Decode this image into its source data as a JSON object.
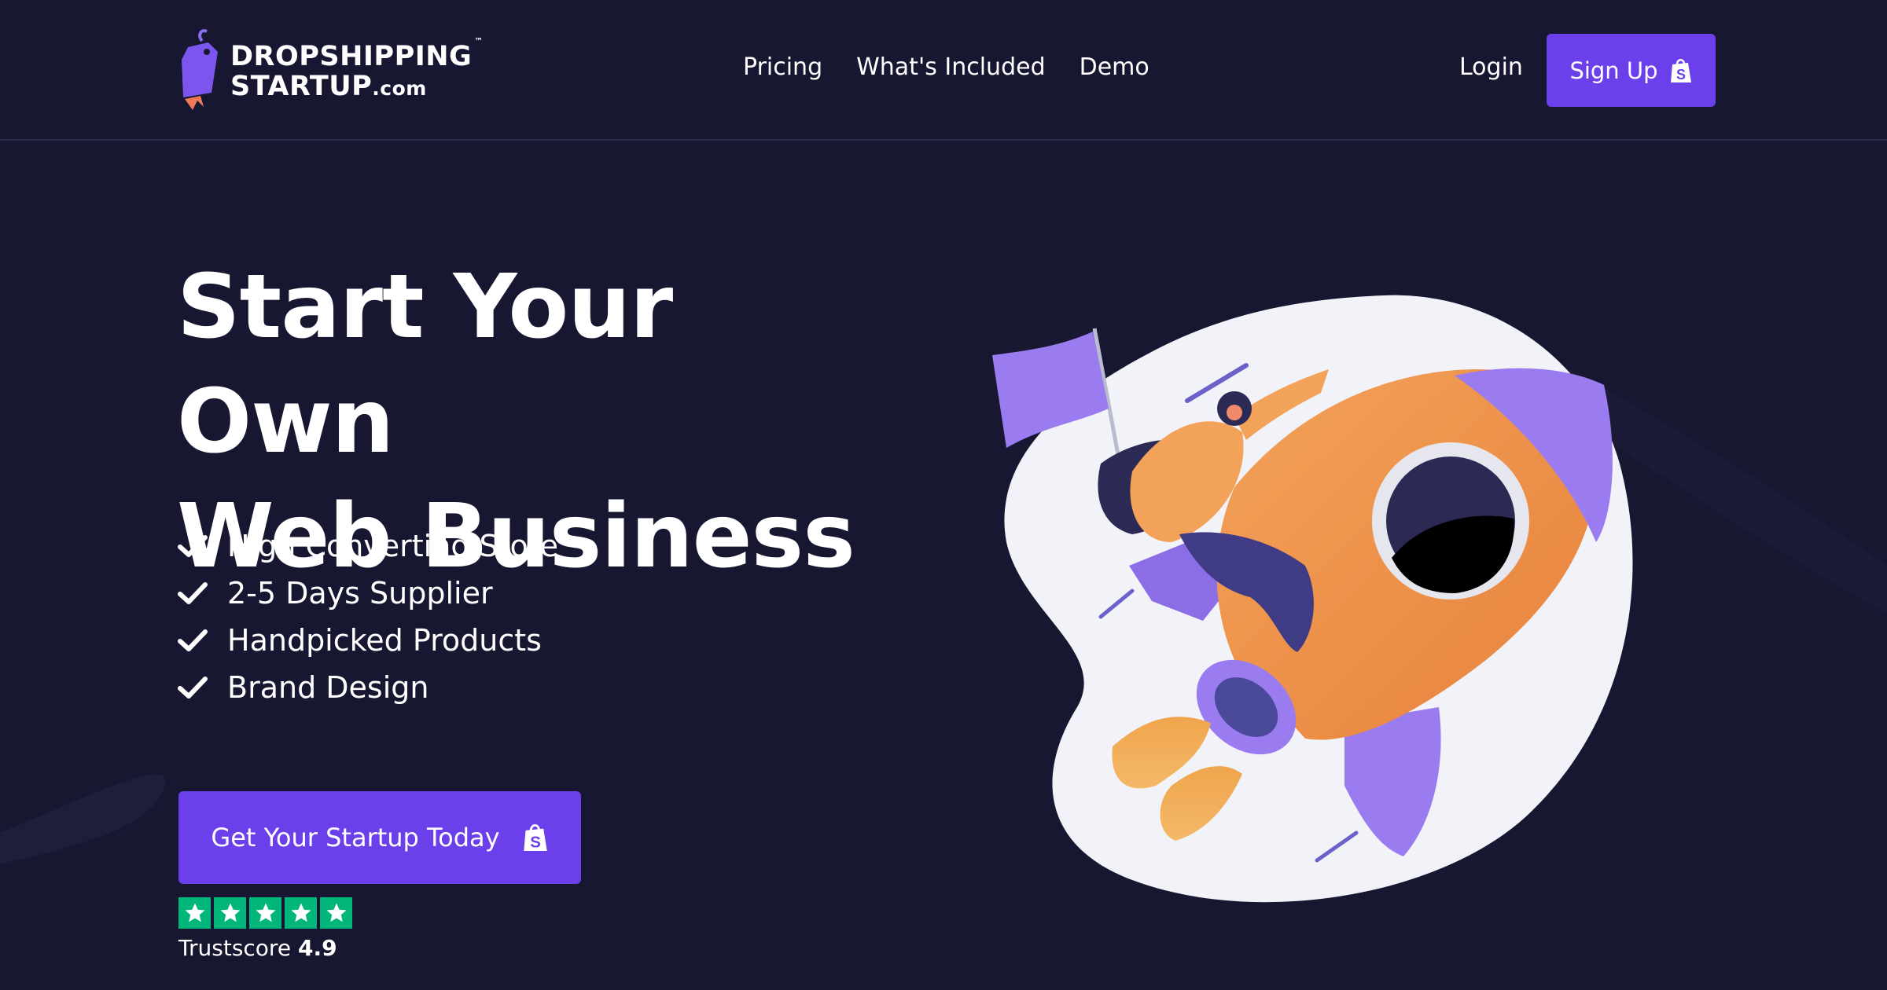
{
  "brand": {
    "line1": "DROPSHIPPING",
    "line2": "STARTUP",
    "line2_suffix": ".com",
    "trademark": "™",
    "icon": "price-tag-rocket-icon"
  },
  "nav": {
    "items": [
      {
        "label": "Pricing"
      },
      {
        "label": "What's Included"
      },
      {
        "label": "Demo"
      }
    ]
  },
  "auth": {
    "login_label": "Login",
    "signup_label": "Sign Up",
    "signup_icon": "shopify-bag-icon"
  },
  "hero": {
    "headline_line1": "Start Your Own",
    "headline_line2": "Web Business",
    "features": [
      {
        "label": "High Converting Store"
      },
      {
        "label": "2-5 Days Supplier"
      },
      {
        "label": "Handpicked Products"
      },
      {
        "label": "Brand Design"
      }
    ],
    "cta_label": "Get Your Startup Today",
    "cta_icon": "shopify-bag-icon"
  },
  "trust": {
    "rating_stars": 5,
    "label": "Trustscore",
    "score": "4.9"
  },
  "colors": {
    "background": "#181731",
    "accent": "#6b3fea",
    "trustpilot_green": "#00b67a",
    "rocket_orange": "#ee8a3e",
    "rocket_purple": "#9b7cf0"
  }
}
